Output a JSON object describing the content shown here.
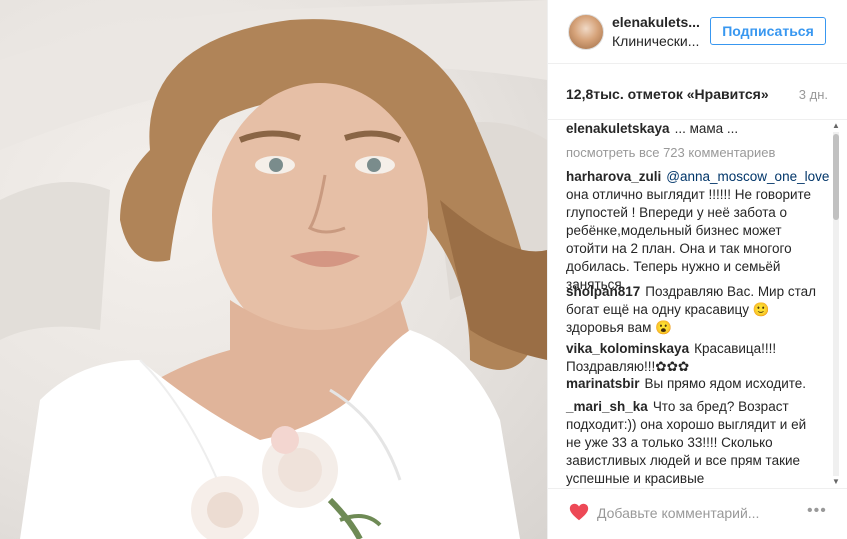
{
  "photo": {
    "description_colors": {
      "background": "#e8e4e0",
      "hair": "#b08458",
      "skin": "#e8c0a8",
      "top": "#ffffff"
    }
  },
  "header": {
    "username": "elenakulets...",
    "location": "Клинически...",
    "follow_label": "Подписаться",
    "accent": "#3897f0"
  },
  "meta": {
    "likes": "12,8тыс. отметок «Нравится»",
    "time": "3 дн."
  },
  "caption": {
    "user": "elenakuletskaya",
    "text": "... мама ..."
  },
  "view_all": "посмотреть все 723 комментариев",
  "comments": [
    {
      "user": "harharova_zuli",
      "mention": "@anna_moscow_one_love",
      "text": "она отлично выглядит !!!!!! Не говорите глупостей ! Впереди у неё забота о ребёнке,модельный бизнес может отойти на 2 план. Она и так многого добилась. Теперь нужно и семьёй заняться"
    },
    {
      "user": "sholpan817",
      "text": "Поздравляю Вас. Мир стал богат ещё на одну красавицу 🙂 здоровья вам 😮"
    },
    {
      "user": "vika_kolominskaya",
      "text": "Красавица!!!! Поздравляю!!!✿✿✿"
    },
    {
      "user": "marinatsbir",
      "text": "Вы прямо ядом исходите."
    },
    {
      "user": "_mari_sh_ka",
      "text": "Что за бред? Возраст подходит:)) она хорошо выглядит и ей не уже 33 а только 33!!!! Сколько завистливых людей и все прям такие успешные и красивые"
    }
  ],
  "footer": {
    "placeholder": "Добавьте комментарий...",
    "more": "•••",
    "heart_color": "#ed4956"
  },
  "scrollbar": {
    "up": "▲",
    "down": "▼"
  }
}
